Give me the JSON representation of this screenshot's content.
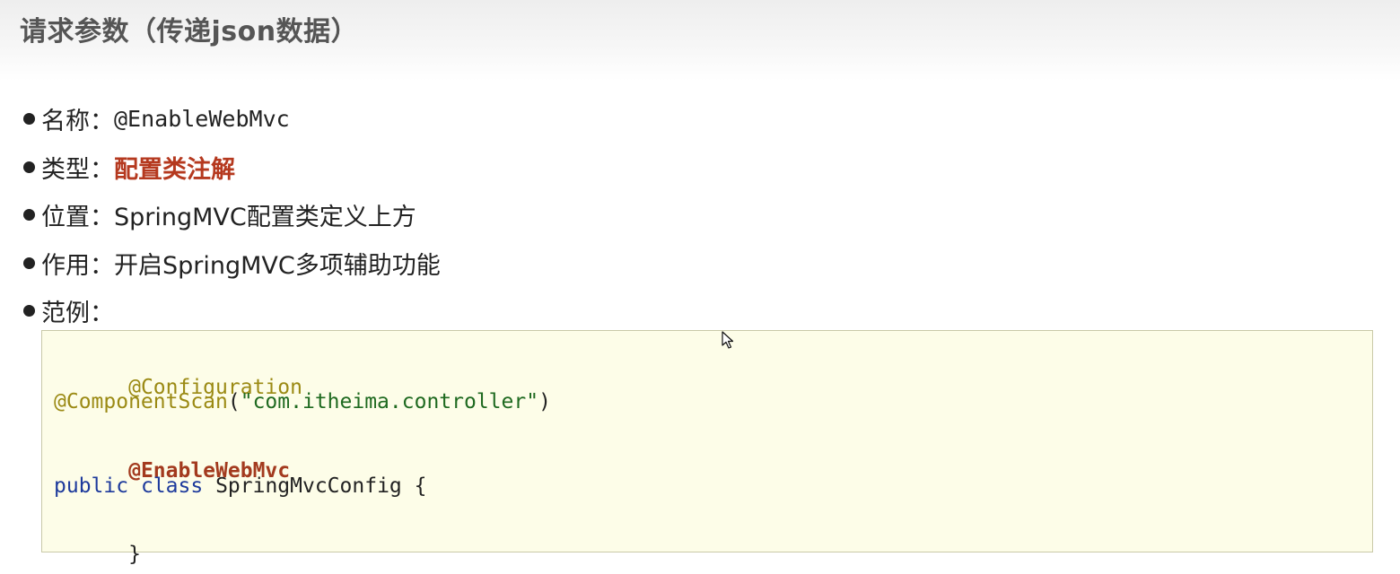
{
  "header": {
    "title": "请求参数（传递json数据）"
  },
  "info": {
    "name_label": "名称：",
    "name_value": "@EnableWebMvc",
    "type_label": "类型：",
    "type_value": "配置类注解",
    "position_label": "位置：",
    "position_value": "SpringMVC配置类定义上方",
    "function_label": "作用：",
    "function_value": "开启SpringMVC多项辅助功能",
    "example_label": "范例："
  },
  "code": {
    "line1": "@Configuration",
    "line2_annotation": "@ComponentScan",
    "line2_open": "(",
    "line2_string": "\"com.itheima.controller\"",
    "line2_close": ")",
    "line3": "@EnableWebMvc",
    "line4_kw1": "public",
    "line4_kw2": "class",
    "line4_rest": "SpringMvcConfig {",
    "line5": "}"
  },
  "colors": {
    "accent_red": "#b5391f",
    "annotation": "#9b8a14",
    "string": "#1f6a20",
    "keyword": "#1d3a9c",
    "code_background": "#fdfde8"
  },
  "icons": {
    "cursor": "mouse-pointer-icon",
    "bullet": "bullet-dot-icon"
  }
}
